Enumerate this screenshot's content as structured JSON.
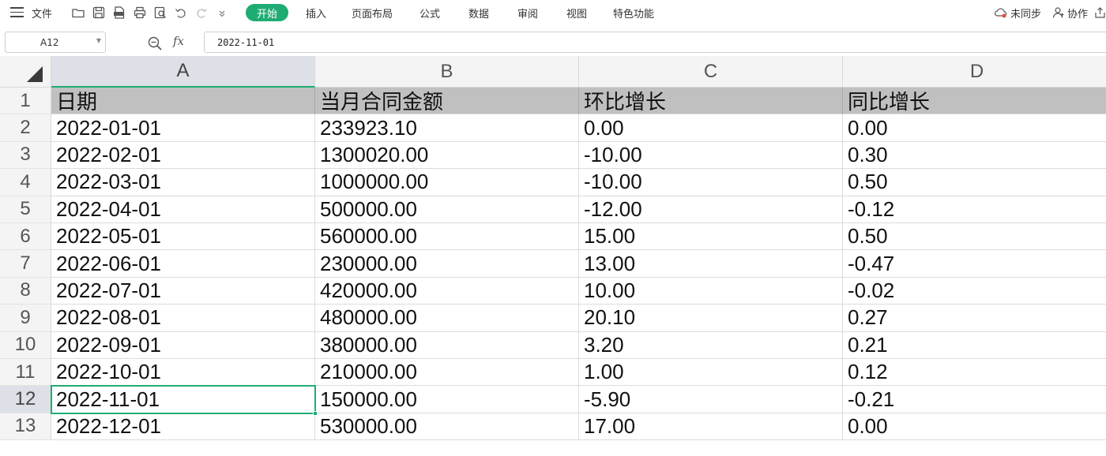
{
  "menu": {
    "file_label": "文件",
    "tabs": [
      "开始",
      "插入",
      "页面布局",
      "公式",
      "数据",
      "审阅",
      "视图",
      "特色功能"
    ],
    "active_tab": "开始",
    "sync_label": "未同步",
    "collab_label": "协作",
    "quick_icons": [
      "open-folder-icon",
      "save-icon",
      "pdf-export-icon",
      "print-icon",
      "print-preview-icon",
      "undo-icon",
      "redo-icon",
      "customize-dropdown-icon"
    ]
  },
  "formula_bar": {
    "cell_ref": "A12",
    "fx_label": "fx",
    "value": "2022-11-01"
  },
  "grid": {
    "columns": [
      "A",
      "B",
      "C",
      "D"
    ],
    "selected_column": "A",
    "selected_row": 12,
    "rows": [
      {
        "num": "1",
        "cells": [
          "日期",
          "当月合同金额",
          "环比增长",
          "同比增长"
        ]
      },
      {
        "num": "2",
        "cells": [
          "2022-01-01",
          "233923.10",
          "0.00",
          "0.00"
        ]
      },
      {
        "num": "3",
        "cells": [
          "2022-02-01",
          "1300020.00",
          "-10.00",
          "0.30"
        ]
      },
      {
        "num": "4",
        "cells": [
          "2022-03-01",
          "1000000.00",
          "-10.00",
          "0.50"
        ]
      },
      {
        "num": "5",
        "cells": [
          "2022-04-01",
          "500000.00",
          "-12.00",
          "-0.12"
        ]
      },
      {
        "num": "6",
        "cells": [
          "2022-05-01",
          "560000.00",
          "15.00",
          "0.50"
        ]
      },
      {
        "num": "7",
        "cells": [
          "2022-06-01",
          "230000.00",
          "13.00",
          "-0.47"
        ]
      },
      {
        "num": "8",
        "cells": [
          "2022-07-01",
          "420000.00",
          "10.00",
          "-0.02"
        ]
      },
      {
        "num": "9",
        "cells": [
          "2022-08-01",
          "480000.00",
          "20.10",
          "0.27"
        ]
      },
      {
        "num": "10",
        "cells": [
          "2022-09-01",
          "380000.00",
          "3.20",
          "0.21"
        ]
      },
      {
        "num": "11",
        "cells": [
          "2022-10-01",
          "210000.00",
          "1.00",
          "0.12"
        ]
      },
      {
        "num": "12",
        "cells": [
          "2022-11-01",
          "150000.00",
          "-5.90",
          "-0.21"
        ]
      },
      {
        "num": "13",
        "cells": [
          "2022-12-01",
          "530000.00",
          "17.00",
          "0.00"
        ]
      }
    ]
  },
  "colors": {
    "accent": "#1fac73",
    "header_row_fill": "#c0c0c0",
    "selected_header_fill": "#dde0e7"
  }
}
